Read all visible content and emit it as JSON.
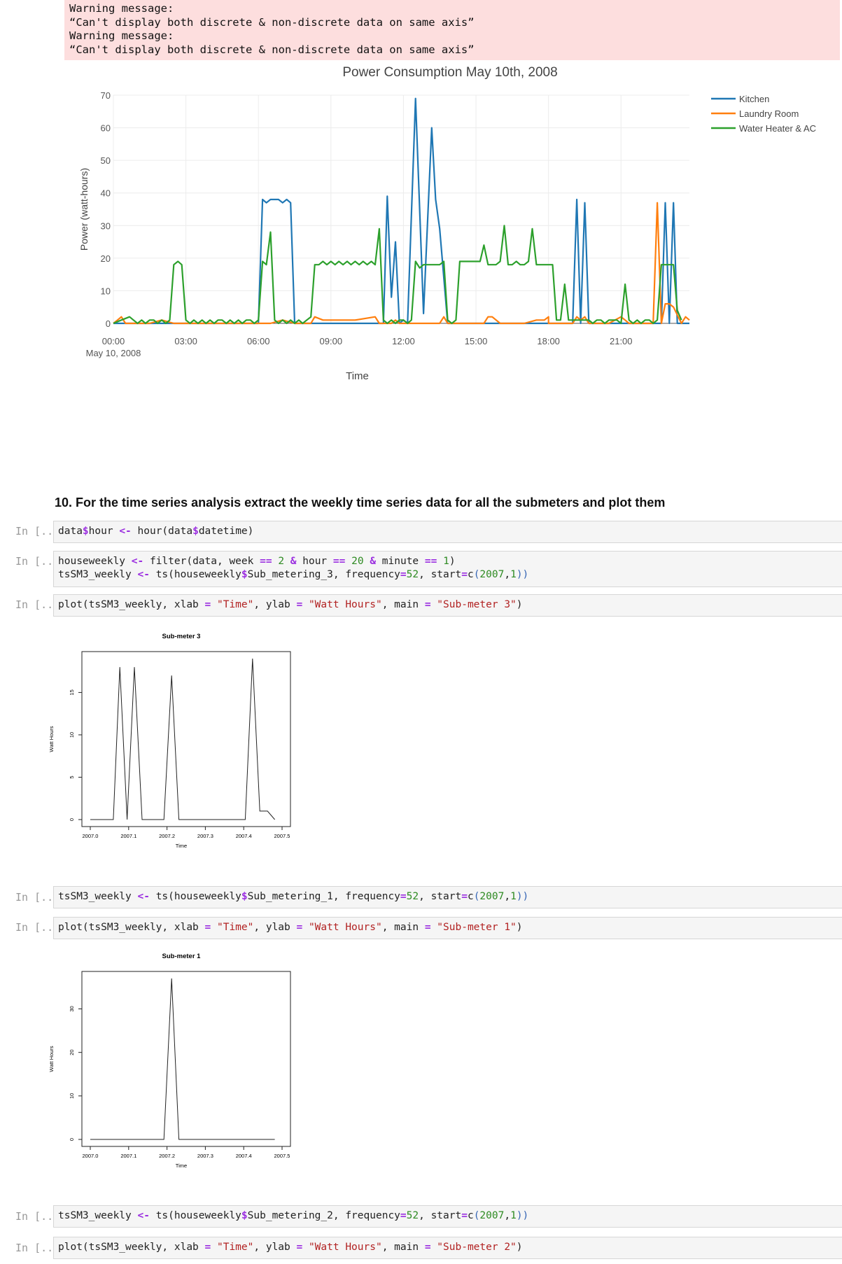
{
  "warnings": [
    "Warning message:",
    "“Can't display both discrete & non-discrete data on same axis”",
    "Warning message:",
    "“Can't display both discrete & non-discrete data on same axis”"
  ],
  "main_chart": {
    "type": "line",
    "title": "Power Consumption May 10th, 2008",
    "xlabel": "Time",
    "ylabel": "Power (watt-hours)",
    "x_ticks": [
      "00:00",
      "03:00",
      "06:00",
      "09:00",
      "12:00",
      "15:00",
      "18:00",
      "21:00"
    ],
    "x_tick_sub": "May 10, 2008",
    "y_ticks": [
      "0",
      "10",
      "20",
      "30",
      "40",
      "50",
      "60",
      "70"
    ],
    "ylim": [
      0,
      70
    ],
    "xlim_hours": [
      0,
      23.83
    ],
    "legend_position": "top-right",
    "series": [
      {
        "name": "Kitchen",
        "color": "#1f77b4",
        "x": [
          0,
          6,
          6.17,
          6.33,
          6.5,
          6.67,
          6.83,
          7,
          7.17,
          7.33,
          7.5,
          7.67,
          11,
          11.17,
          11.33,
          11.5,
          11.67,
          11.83,
          12,
          12.17,
          12.5,
          12.83,
          13.17,
          13.33,
          13.5,
          13.83,
          14,
          19,
          19.17,
          19.33,
          19.5,
          19.67,
          19.83,
          22.5,
          22.67,
          22.83,
          23,
          23.17,
          23.33,
          23.5,
          23.67,
          23.83
        ],
        "y": [
          0,
          0,
          38,
          37,
          38,
          38,
          38,
          37,
          38,
          37,
          0,
          0,
          0,
          0,
          39,
          8,
          25,
          0,
          1,
          0,
          69,
          3,
          60,
          38,
          29,
          0,
          0,
          0,
          38,
          0,
          37,
          0,
          0,
          0,
          0,
          37,
          0,
          37,
          0,
          0,
          0,
          0
        ]
      },
      {
        "name": "Laundry Room",
        "color": "#ff7f0e",
        "x": [
          0,
          0.17,
          0.33,
          0.5,
          0.67,
          1,
          1.5,
          2,
          2.5,
          3,
          4,
          5,
          6,
          6.5,
          7,
          7.5,
          8,
          8.17,
          8.33,
          8.67,
          9,
          10,
          10.83,
          11,
          11.5,
          11.67,
          11.83,
          12,
          13,
          13.5,
          13.67,
          13.83,
          14,
          14.5,
          15,
          15.33,
          15.5,
          15.67,
          16,
          17,
          17.5,
          17.83,
          18,
          18,
          19,
          19.17,
          19.33,
          19.5,
          19.67,
          19.83,
          20.5,
          21,
          21.17,
          21.33,
          22,
          22.33,
          22.5,
          22.67,
          22.83,
          23,
          23.17,
          23.5,
          23.67,
          23.83
        ],
        "y": [
          0,
          1,
          2,
          0,
          0,
          0,
          0,
          1,
          0,
          0,
          0,
          0,
          0,
          0,
          1,
          0,
          0,
          0,
          2,
          1,
          1,
          1,
          2,
          0,
          0,
          1,
          0,
          0,
          0,
          0,
          2,
          0,
          0,
          0,
          0,
          0,
          2,
          2,
          0,
          0,
          1,
          1,
          2,
          0,
          0,
          2,
          1,
          2,
          0,
          0,
          0,
          2,
          1,
          0,
          0,
          0,
          37,
          0,
          6,
          6,
          5,
          0,
          2,
          1
        ]
      },
      {
        "name": "Water Heater & AC",
        "color": "#2ca02c",
        "x": [
          0,
          0.33,
          0.67,
          0.83,
          1,
          1.17,
          1.33,
          1.5,
          1.67,
          1.83,
          2,
          2.17,
          2.33,
          2.5,
          2.67,
          2.83,
          3,
          3.17,
          3.33,
          3.5,
          3.67,
          3.83,
          4,
          4.17,
          4.33,
          4.5,
          4.67,
          4.83,
          5,
          5.17,
          5.33,
          5.5,
          5.67,
          5.83,
          6,
          6.17,
          6.33,
          6.5,
          6.67,
          6.83,
          7,
          7.17,
          7.33,
          7.5,
          7.67,
          7.83,
          8,
          8.17,
          8.33,
          8.5,
          8.67,
          8.83,
          9,
          9.17,
          9.33,
          9.5,
          9.67,
          9.83,
          10,
          10.17,
          10.33,
          10.5,
          10.67,
          10.83,
          11,
          11.17,
          11.33,
          11.5,
          11.67,
          11.83,
          12,
          12.17,
          12.33,
          12.5,
          12.67,
          12.83,
          13,
          13.17,
          13.33,
          13.5,
          13.67,
          13.83,
          14,
          14.17,
          14.33,
          14.5,
          14.67,
          15,
          15.17,
          15.33,
          15.5,
          15.67,
          15.83,
          16,
          16.17,
          16.33,
          16.5,
          16.67,
          16.83,
          17,
          17.17,
          17.33,
          17.5,
          17.67,
          17.83,
          18,
          18.17,
          18.33,
          18.5,
          18.67,
          18.83,
          19,
          19.17,
          19.33,
          19.5,
          19.67,
          19.83,
          20,
          20.17,
          20.33,
          20.5,
          20.67,
          20.83,
          21,
          21.17,
          21.33,
          21.5,
          21.67,
          21.83,
          22,
          22.17,
          22.33,
          22.5,
          22.67,
          22.83,
          23,
          23.17,
          23.33,
          23.5,
          23.67,
          23.83
        ],
        "y": [
          0,
          1,
          2,
          1,
          0,
          1,
          0,
          1,
          1,
          0,
          1,
          0,
          1,
          18,
          19,
          18,
          1,
          0,
          1,
          0,
          1,
          0,
          1,
          0,
          1,
          1,
          0,
          1,
          0,
          1,
          0,
          1,
          1,
          0,
          1,
          19,
          18,
          28,
          1,
          0,
          1,
          0,
          1,
          0,
          1,
          0,
          1,
          2,
          18,
          18,
          19,
          18,
          19,
          18,
          19,
          18,
          19,
          18,
          19,
          18,
          19,
          18,
          19,
          18,
          29,
          1,
          0,
          1,
          0,
          1,
          1,
          0,
          1,
          19,
          17,
          18,
          18,
          18,
          18,
          18,
          19,
          1,
          0,
          1,
          19,
          19,
          19,
          19,
          19,
          24,
          18,
          18,
          18,
          19,
          30,
          18,
          18,
          19,
          18,
          18,
          19,
          29,
          18,
          18,
          18,
          18,
          18,
          1,
          1,
          12,
          1,
          1,
          1,
          1,
          1,
          1,
          0,
          1,
          1,
          0,
          1,
          1,
          1,
          0,
          12,
          1,
          0,
          1,
          0,
          1,
          1,
          0,
          1,
          18,
          18,
          18,
          18,
          4,
          1
        ]
      }
    ]
  },
  "section_heading": "10. For the time series analysis extract the weekly time series data for all the submeters and plot them",
  "prompt_label": "In [...",
  "cells": [
    {
      "id": "c1",
      "lines": [
        [
          {
            "t": "data",
            "c": ""
          },
          {
            "t": "$",
            "c": "op"
          },
          {
            "t": "hour ",
            "c": ""
          },
          {
            "t": "<-",
            "c": "op"
          },
          {
            "t": " hour(data",
            "c": ""
          },
          {
            "t": "$",
            "c": "op"
          },
          {
            "t": "datetime)",
            "c": ""
          }
        ]
      ]
    },
    {
      "id": "c2",
      "lines": [
        [
          {
            "t": "houseweekly ",
            "c": ""
          },
          {
            "t": "<-",
            "c": "op"
          },
          {
            "t": " filter(data, week ",
            "c": ""
          },
          {
            "t": "==",
            "c": "op"
          },
          {
            "t": " ",
            "c": ""
          },
          {
            "t": "2",
            "c": "num"
          },
          {
            "t": " ",
            "c": ""
          },
          {
            "t": "&",
            "c": "op"
          },
          {
            "t": " hour ",
            "c": ""
          },
          {
            "t": "==",
            "c": "op"
          },
          {
            "t": " ",
            "c": ""
          },
          {
            "t": "20",
            "c": "num"
          },
          {
            "t": " ",
            "c": ""
          },
          {
            "t": "&",
            "c": "op"
          },
          {
            "t": " minute ",
            "c": ""
          },
          {
            "t": "==",
            "c": "op"
          },
          {
            "t": " ",
            "c": ""
          },
          {
            "t": "1",
            "c": "num"
          },
          {
            "t": ")",
            "c": ""
          }
        ],
        [
          {
            "t": "tsSM3_weekly ",
            "c": ""
          },
          {
            "t": "<-",
            "c": "op"
          },
          {
            "t": " ts(houseweekly",
            "c": ""
          },
          {
            "t": "$",
            "c": "op"
          },
          {
            "t": "Sub_metering_3, frequency",
            "c": ""
          },
          {
            "t": "=",
            "c": "op"
          },
          {
            "t": "52",
            "c": "num"
          },
          {
            "t": ", start",
            "c": ""
          },
          {
            "t": "=",
            "c": "op"
          },
          {
            "t": "c",
            "c": ""
          },
          {
            "t": "(",
            "c": "par"
          },
          {
            "t": "2007",
            "c": "num"
          },
          {
            "t": ",",
            "c": ""
          },
          {
            "t": "1",
            "c": "num"
          },
          {
            "t": "))",
            "c": "par"
          }
        ]
      ]
    },
    {
      "id": "c3",
      "lines": [
        [
          {
            "t": "plot(tsSM3_weekly, xlab ",
            "c": ""
          },
          {
            "t": "=",
            "c": "op"
          },
          {
            "t": " ",
            "c": ""
          },
          {
            "t": "\"Time\"",
            "c": "str"
          },
          {
            "t": ", ylab ",
            "c": ""
          },
          {
            "t": "=",
            "c": "op"
          },
          {
            "t": " ",
            "c": ""
          },
          {
            "t": "\"Watt Hours\"",
            "c": "str"
          },
          {
            "t": ", main ",
            "c": ""
          },
          {
            "t": "=",
            "c": "op"
          },
          {
            "t": " ",
            "c": ""
          },
          {
            "t": "\"Sub-meter 3\"",
            "c": "str"
          },
          {
            "t": ")",
            "c": ""
          }
        ]
      ]
    },
    {
      "id": "c4",
      "lines": [
        [
          {
            "t": "tsSM3_weekly ",
            "c": ""
          },
          {
            "t": "<-",
            "c": "op"
          },
          {
            "t": " ts(houseweekly",
            "c": ""
          },
          {
            "t": "$",
            "c": "op"
          },
          {
            "t": "Sub_metering_1, frequency",
            "c": ""
          },
          {
            "t": "=",
            "c": "op"
          },
          {
            "t": "52",
            "c": "num"
          },
          {
            "t": ", start",
            "c": ""
          },
          {
            "t": "=",
            "c": "op"
          },
          {
            "t": "c",
            "c": ""
          },
          {
            "t": "(",
            "c": "par"
          },
          {
            "t": "2007",
            "c": "num"
          },
          {
            "t": ",",
            "c": ""
          },
          {
            "t": "1",
            "c": "num"
          },
          {
            "t": "))",
            "c": "par"
          }
        ]
      ]
    },
    {
      "id": "c5",
      "lines": [
        [
          {
            "t": "plot(tsSM3_weekly, xlab ",
            "c": ""
          },
          {
            "t": "=",
            "c": "op"
          },
          {
            "t": " ",
            "c": ""
          },
          {
            "t": "\"Time\"",
            "c": "str"
          },
          {
            "t": ", ylab ",
            "c": ""
          },
          {
            "t": "=",
            "c": "op"
          },
          {
            "t": " ",
            "c": ""
          },
          {
            "t": "\"Watt Hours\"",
            "c": "str"
          },
          {
            "t": ", main ",
            "c": ""
          },
          {
            "t": "=",
            "c": "op"
          },
          {
            "t": " ",
            "c": ""
          },
          {
            "t": "\"Sub-meter 1\"",
            "c": "str"
          },
          {
            "t": ")",
            "c": ""
          }
        ]
      ]
    },
    {
      "id": "c6",
      "lines": [
        [
          {
            "t": "tsSM3_weekly ",
            "c": ""
          },
          {
            "t": "<-",
            "c": "op"
          },
          {
            "t": " ts(houseweekly",
            "c": ""
          },
          {
            "t": "$",
            "c": "op"
          },
          {
            "t": "Sub_metering_2, frequency",
            "c": ""
          },
          {
            "t": "=",
            "c": "op"
          },
          {
            "t": "52",
            "c": "num"
          },
          {
            "t": ", start",
            "c": ""
          },
          {
            "t": "=",
            "c": "op"
          },
          {
            "t": "c",
            "c": ""
          },
          {
            "t": "(",
            "c": "par"
          },
          {
            "t": "2007",
            "c": "num"
          },
          {
            "t": ",",
            "c": ""
          },
          {
            "t": "1",
            "c": "num"
          },
          {
            "t": "))",
            "c": "par"
          }
        ]
      ]
    },
    {
      "id": "c7",
      "lines": [
        [
          {
            "t": "plot(tsSM3_weekly, xlab ",
            "c": ""
          },
          {
            "t": "=",
            "c": "op"
          },
          {
            "t": " ",
            "c": ""
          },
          {
            "t": "\"Time\"",
            "c": "str"
          },
          {
            "t": ", ylab ",
            "c": ""
          },
          {
            "t": "=",
            "c": "op"
          },
          {
            "t": " ",
            "c": ""
          },
          {
            "t": "\"Watt Hours\"",
            "c": "str"
          },
          {
            "t": ", main ",
            "c": ""
          },
          {
            "t": "=",
            "c": "op"
          },
          {
            "t": " ",
            "c": ""
          },
          {
            "t": "\"Sub-meter 2\"",
            "c": "str"
          },
          {
            "t": ")",
            "c": ""
          }
        ]
      ]
    }
  ],
  "chart_data": [
    {
      "type": "line",
      "title": "Sub-meter 3",
      "xlabel": "Time",
      "ylabel": "Watt Hours",
      "x_ticks": [
        "2007.0",
        "2007.1",
        "2007.2",
        "2007.3",
        "2007.4",
        "2007.5"
      ],
      "y_ticks": [
        "0",
        "5",
        "10",
        "15"
      ],
      "xlim": [
        2007.0,
        2007.5
      ],
      "ylim": [
        0,
        19
      ],
      "x": [
        2007.0,
        2007.02,
        2007.04,
        2007.06,
        2007.077,
        2007.096,
        2007.115,
        2007.135,
        2007.154,
        2007.173,
        2007.192,
        2007.212,
        2007.231,
        2007.25,
        2007.269,
        2007.288,
        2007.308,
        2007.327,
        2007.346,
        2007.365,
        2007.385,
        2007.404,
        2007.423,
        2007.442,
        2007.462,
        2007.481
      ],
      "y": [
        0,
        0,
        0,
        0,
        18,
        0,
        18,
        0,
        0,
        0,
        0,
        17,
        0,
        0,
        0,
        0,
        0,
        0,
        0,
        0,
        0,
        0,
        19,
        1,
        1,
        0
      ]
    },
    {
      "type": "line",
      "title": "Sub-meter 1",
      "xlabel": "Time",
      "ylabel": "Watt Hours",
      "x_ticks": [
        "2007.0",
        "2007.1",
        "2007.2",
        "2007.3",
        "2007.4",
        "2007.5"
      ],
      "y_ticks": [
        "0",
        "10",
        "20",
        "30"
      ],
      "xlim": [
        2007.0,
        2007.5
      ],
      "ylim": [
        0,
        37
      ],
      "x": [
        2007.0,
        2007.02,
        2007.04,
        2007.06,
        2007.077,
        2007.096,
        2007.115,
        2007.135,
        2007.154,
        2007.173,
        2007.192,
        2007.212,
        2007.231,
        2007.25,
        2007.269,
        2007.288,
        2007.308,
        2007.327,
        2007.346,
        2007.365,
        2007.385,
        2007.404,
        2007.423,
        2007.442,
        2007.462,
        2007.481
      ],
      "y": [
        0,
        0,
        0,
        0,
        0,
        0,
        0,
        0,
        0,
        0,
        0,
        37,
        0,
        0,
        0,
        0,
        0,
        0,
        0,
        0,
        0,
        0,
        0,
        0,
        0,
        0
      ]
    }
  ]
}
